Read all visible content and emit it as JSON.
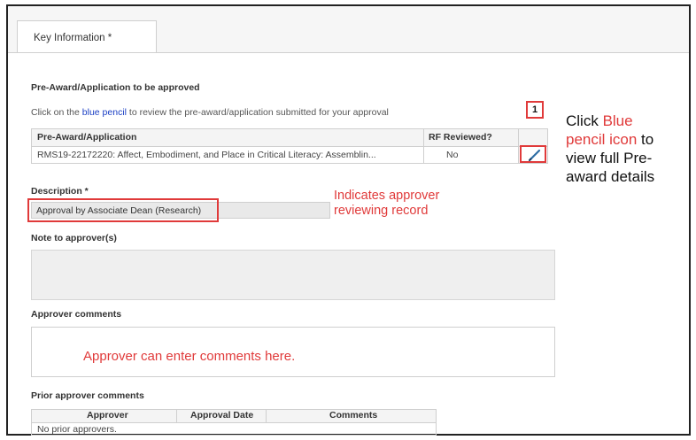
{
  "tab": {
    "label": "Key Information *"
  },
  "section": {
    "title": "Pre-Award/Application to be approved",
    "instruction_pre": "Click on the ",
    "instruction_link": "blue pencil",
    "instruction_post": " to review the pre-award/application submitted for your approval"
  },
  "grid": {
    "col1_header": "Pre-Award/Application",
    "col2_header": "RF Reviewed?",
    "row_text": "RMS19-22172220: Affect, Embodiment, and Place in Critical Literacy: Assemblin...",
    "row_reviewed": "No",
    "edit_icon": "pencil-icon"
  },
  "step_marker": "1",
  "callout": {
    "line1_pre": "Click ",
    "line1_red": "Blue",
    "line2_red": "pencil icon",
    "line2_post": " to",
    "line3": "view full Pre-",
    "line4": "award details"
  },
  "description": {
    "label": "Description *",
    "value": "Approval by Associate Dean (Research)",
    "annotation_line1": "Indicates approver",
    "annotation_line2": "reviewing record"
  },
  "note": {
    "label": "Note to approver(s)"
  },
  "approver_comments": {
    "label": "Approver comments",
    "hint": "Approver can enter comments here."
  },
  "prior": {
    "label": "Prior approver comments",
    "headers": [
      "Approver",
      "Approval Date",
      "Comments"
    ],
    "empty_text": "No prior approvers."
  },
  "colors": {
    "accent_red": "#e03a3a",
    "link_blue": "#1a3fc4"
  }
}
